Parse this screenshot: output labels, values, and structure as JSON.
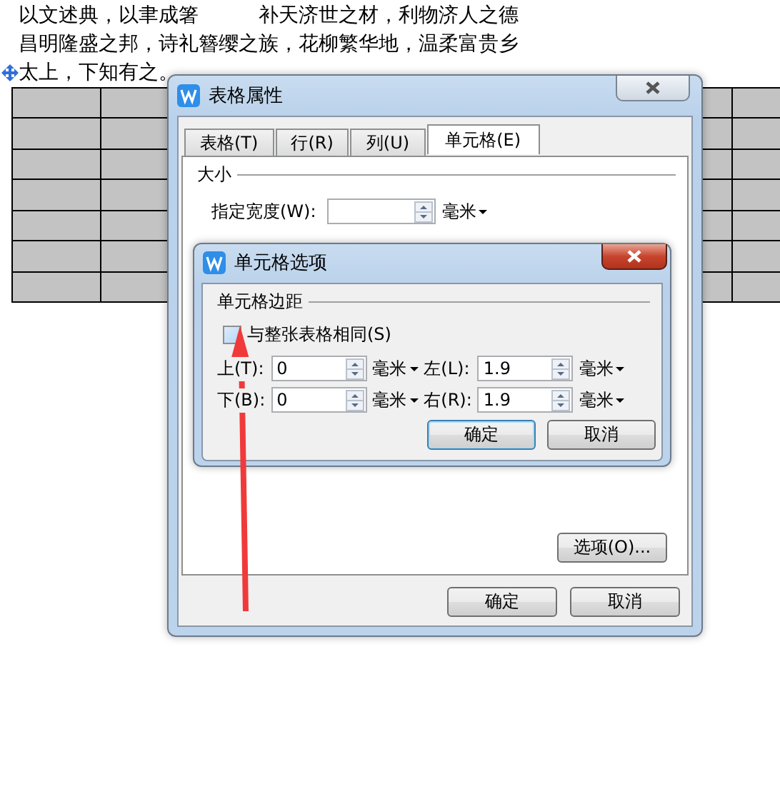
{
  "document": {
    "lines": [
      "以文述典，以聿成箸　　　补天济世之材，利物济人之德",
      "昌明隆盛之邦，诗礼簪缨之族，花柳繁华地，温柔富贵乡",
      "太上，下知有之。"
    ]
  },
  "table_properties_dialog": {
    "title": "表格属性",
    "tabs": [
      {
        "label": "表格(T)",
        "selected": false
      },
      {
        "label": "行(R)",
        "selected": false
      },
      {
        "label": "列(U)",
        "selected": false
      },
      {
        "label": "单元格(E)",
        "selected": true
      }
    ],
    "size_section": {
      "heading": "大小",
      "width_label": "指定宽度(W):",
      "unit": "毫米"
    },
    "options_button": "选项(O)...",
    "buttons": [
      "确定",
      "取消"
    ]
  },
  "cell_options_dialog": {
    "title": "单元格选项",
    "section": "单元格边距",
    "same_as_table": {
      "label": "与整张表格相同(S)",
      "checked": false
    },
    "margins": [
      {
        "label": "上(T):",
        "value": "0",
        "unit": "毫米"
      },
      {
        "label": "左(L):",
        "value": "1.9",
        "unit": "毫米"
      },
      {
        "label": "下(B):",
        "value": "0",
        "unit": "毫米"
      },
      {
        "label": "右(R):",
        "value": "1.9",
        "unit": "毫米"
      }
    ],
    "buttons": [
      "确定",
      "取消"
    ]
  }
}
